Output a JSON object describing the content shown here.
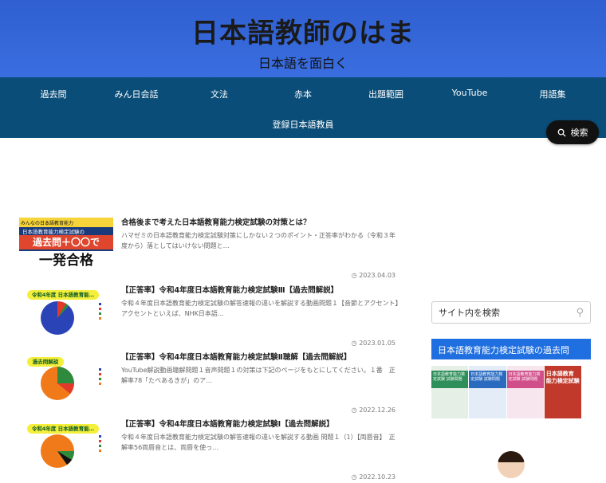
{
  "header": {
    "site_title": "日本語教師のはま",
    "tagline": "日本語を面白く"
  },
  "nav": {
    "items": [
      "過去問",
      "みん日会話",
      "文法",
      "赤本",
      "出題範囲",
      "YouTube",
      "用語集",
      "登録日本語教員"
    ]
  },
  "search_pill": {
    "label": "検索"
  },
  "posts": [
    {
      "title": "合格後まで考えた日本語教育能力検定試験の対策とは？",
      "excerpt": "ハマゼミの日本語教育能力検定試験対策にしかない２つのポイント・正答率がわかる（令和３年度から）落としてはいけない問題と…",
      "date": "2023.04.03",
      "thumb_top": "みんなの日本語教育能力",
      "thumb_line1": "日本語教育能力検定試験の",
      "thumb_line2": "過去問＋〇〇で",
      "thumb_line3": "一発合格"
    },
    {
      "title": "【正答率】令和4年度日本語教育能力検定試験Ⅲ【過去問解説】",
      "excerpt": "令和４年度日本語教育能力検定試験の解答速報の違いを解説する動画問題１【音節とアクセント】アクセントといえば、NHK日本語…",
      "date": "2023.01.05",
      "thumb_label": "令和4年度 日本語教育能…"
    },
    {
      "title": "【正答率】令和4年度日本語教育能力検定試験Ⅱ聴解【過去問解説】",
      "excerpt": "YouTube解説動画聴解問題１音声問題１の対策は下記のページをもとにしてください。１番　正解率78「たべあるきが」のア…",
      "date": "2022.12.26",
      "thumb_label": "過去問解説"
    },
    {
      "title": "【正答率】令和4年度日本語教育能力検定試験Ⅰ【過去問解説】",
      "excerpt": "令和４年度日本語教育能力検定試験の解答速報の違いを解説する動画 問題１（1）【両唇音】　正解率56両唇音とは、両唇を使っ…",
      "date": "2022.10.23",
      "thumb_label": "令和4年度 日本語教育能…"
    }
  ],
  "sidebar": {
    "search_placeholder": "サイト内を検索",
    "widget_title": "日本語教育能力検定試験の過去問",
    "books": [
      {
        "label": "日本語教育能力検定試験 試験問題",
        "color": "#2f8f5a"
      },
      {
        "label": "日本語教育能力検定試験 試験問題",
        "color": "#2a6bc0"
      },
      {
        "label": "日本語教育能力検定試験 試験問題",
        "color": "#d04f8a"
      },
      {
        "label": "日本語教育 能力検定試験",
        "color": "#c0392b"
      }
    ]
  },
  "colors": {
    "header_bg": "#3a6ee0",
    "nav_bg": "#0a4d78",
    "widget_title_bg": "#1f6fe0"
  }
}
